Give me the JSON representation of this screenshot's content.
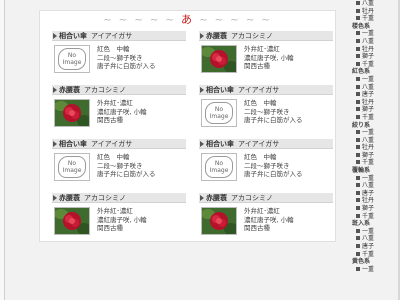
{
  "heading": {
    "decor_left": "~ ~ ~ ~ ~",
    "kana": "あ",
    "decor_right": "~ ~ ~ ~ ~"
  },
  "colors": {
    "bar": "#e6e6e6",
    "panel": "#ffffff",
    "heading_kana": "#c81e1e"
  },
  "no_image_text": {
    "line1": "No",
    "line2": "Image"
  },
  "cards": [
    {
      "variety": "相合い傘",
      "reading": "アイアイガサ",
      "image": "no-image",
      "lines": [
        "紅色　中輪",
        "二段～獅子咲き",
        "唐子弁に白筋が入る"
      ]
    },
    {
      "variety": "赤腰蓑",
      "reading": "アカコシミノ",
      "image": "photo",
      "lines": [
        "外弁紅･濃紅",
        "濃紅唐子咲, 小輪",
        "関西古種"
      ]
    },
    {
      "variety": "赤腰蓑",
      "reading": "アカコシミノ",
      "image": "photo",
      "lines": [
        "外弁紅･濃紅",
        "濃紅唐子咲, 小輪",
        "関西古種"
      ]
    },
    {
      "variety": "相合い傘",
      "reading": "アイアイガサ",
      "image": "no-image",
      "lines": [
        "紅色　中輪",
        "二段～獅子咲き",
        "唐子弁に白筋が入る"
      ]
    },
    {
      "variety": "相合い傘",
      "reading": "アイアイガサ",
      "image": "no-image",
      "lines": [
        "紅色　中輪",
        "二段～獅子咲き",
        "唐子弁に白筋が入る"
      ]
    },
    {
      "variety": "相合い傘",
      "reading": "アイアイガサ",
      "image": "no-image",
      "lines": [
        "紅色　中輪",
        "二段～獅子咲き",
        "唐子弁に白筋が入る"
      ]
    },
    {
      "variety": "赤腰蓑",
      "reading": "アカコシミノ",
      "image": "photo",
      "lines": [
        "外弁紅･濃紅",
        "濃紅唐子咲, 小輪",
        "関西古種"
      ]
    },
    {
      "variety": "赤腰蓑",
      "reading": "アカコシミノ",
      "image": "photo",
      "lines": [
        "外弁紅･濃紅",
        "濃紅唐子咲, 小輪",
        "関西古種"
      ]
    }
  ],
  "right_nav": [
    {
      "kind": "sub",
      "text": "八重"
    },
    {
      "kind": "sub",
      "text": "牡丹"
    },
    {
      "kind": "sub",
      "text": "千重"
    },
    {
      "kind": "cat",
      "text": "楼色系"
    },
    {
      "kind": "sub",
      "text": "一重"
    },
    {
      "kind": "sub",
      "text": "八重"
    },
    {
      "kind": "sub",
      "text": "牡丹"
    },
    {
      "kind": "sub",
      "text": "獅子"
    },
    {
      "kind": "sub",
      "text": "千重"
    },
    {
      "kind": "cat",
      "text": "紅色系"
    },
    {
      "kind": "sub",
      "text": "一重"
    },
    {
      "kind": "sub",
      "text": "八重"
    },
    {
      "kind": "sub",
      "text": "唐子"
    },
    {
      "kind": "sub",
      "text": "牡丹"
    },
    {
      "kind": "sub",
      "text": "獅子"
    },
    {
      "kind": "sub",
      "text": "千重"
    },
    {
      "kind": "cat",
      "text": "絞り系"
    },
    {
      "kind": "sub",
      "text": "一重"
    },
    {
      "kind": "sub",
      "text": "八重"
    },
    {
      "kind": "sub",
      "text": "牡丹"
    },
    {
      "kind": "sub",
      "text": "獅子"
    },
    {
      "kind": "sub",
      "text": "千重"
    },
    {
      "kind": "cat",
      "text": "覆輪系"
    },
    {
      "kind": "sub",
      "text": "一重"
    },
    {
      "kind": "sub",
      "text": "八重"
    },
    {
      "kind": "sub",
      "text": "唐子"
    },
    {
      "kind": "sub",
      "text": "牡丹"
    },
    {
      "kind": "sub",
      "text": "獅子"
    },
    {
      "kind": "sub",
      "text": "千重"
    },
    {
      "kind": "cat",
      "text": "斑入系"
    },
    {
      "kind": "sub",
      "text": "一重"
    },
    {
      "kind": "sub",
      "text": "八重"
    },
    {
      "kind": "sub",
      "text": "唐子"
    },
    {
      "kind": "sub",
      "text": "千重"
    },
    {
      "kind": "cat",
      "text": "黄色系"
    },
    {
      "kind": "sub",
      "text": "一重"
    }
  ]
}
